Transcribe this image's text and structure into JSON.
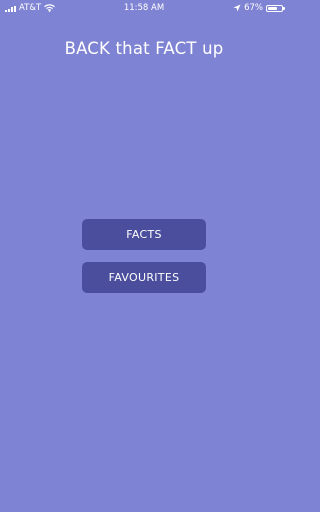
{
  "status_bar": {
    "carrier": "AT&T",
    "time": "11:58 AM",
    "battery_percent": "67%",
    "battery_level": 0.67,
    "icons": [
      "signal-icon",
      "wifi-icon",
      "location-arrow-icon",
      "battery-icon"
    ]
  },
  "app": {
    "title": "BACK that FACT up"
  },
  "menu": {
    "facts_label": "FACTS",
    "favourites_label": "FAVOURITES"
  },
  "colors": {
    "background": "#7f83d3",
    "button": "#4a4e9c",
    "text": "#ffffff"
  }
}
